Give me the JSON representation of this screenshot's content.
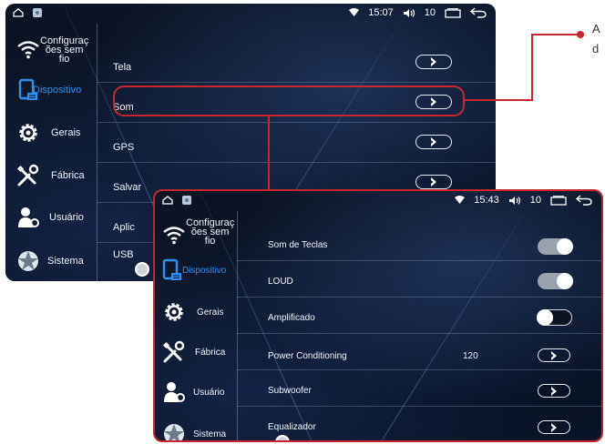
{
  "screen1": {
    "status": {
      "time": "15:07",
      "volume": "10"
    },
    "sidebar": [
      {
        "label": "Configuraç\nões sem\nfio",
        "icon": "wifi-icon"
      },
      {
        "label": "Dispositivo",
        "icon": "device-icon",
        "active": true
      },
      {
        "label": "Gerais",
        "icon": "gear-icon"
      },
      {
        "label": "Fábrica",
        "icon": "tools-icon"
      },
      {
        "label": "Usuário",
        "icon": "user-icon"
      },
      {
        "label": "Sistema",
        "icon": "system-icon"
      }
    ],
    "rows": [
      {
        "label": "Tela"
      },
      {
        "label": "Som"
      },
      {
        "label": "GPS"
      },
      {
        "label": "Salvar"
      },
      {
        "label": "Aplic"
      },
      {
        "label": "USB"
      }
    ]
  },
  "screen2": {
    "status": {
      "time": "15:43",
      "volume": "10"
    },
    "sidebar": [
      {
        "label": "Configuraç\nões sem\nfio",
        "icon": "wifi-icon"
      },
      {
        "label": "Dispositivo",
        "icon": "device-icon",
        "active": true
      },
      {
        "label": "Gerais",
        "icon": "gear-icon"
      },
      {
        "label": "Fábrica",
        "icon": "tools-icon"
      },
      {
        "label": "Usuário",
        "icon": "user-icon"
      },
      {
        "label": "Sistema",
        "icon": "system-icon"
      }
    ],
    "rows": [
      {
        "label": "Som de Teclas",
        "control": "toggle",
        "state": "on"
      },
      {
        "label": "LOUD",
        "control": "toggle",
        "state": "on"
      },
      {
        "label": "Amplificado",
        "control": "toggle",
        "state": "off"
      },
      {
        "label": "Power Conditioning",
        "control": "chevron",
        "value": "120"
      },
      {
        "label": "Subwoofer",
        "control": "chevron"
      },
      {
        "label": "Equalizador",
        "control": "chevron"
      }
    ]
  },
  "callout": {
    "text_line1": "A",
    "text_line2": "d"
  },
  "colors": {
    "accent": "#2f8ff0",
    "highlight": "#c8262e",
    "background": "#0a1428"
  }
}
